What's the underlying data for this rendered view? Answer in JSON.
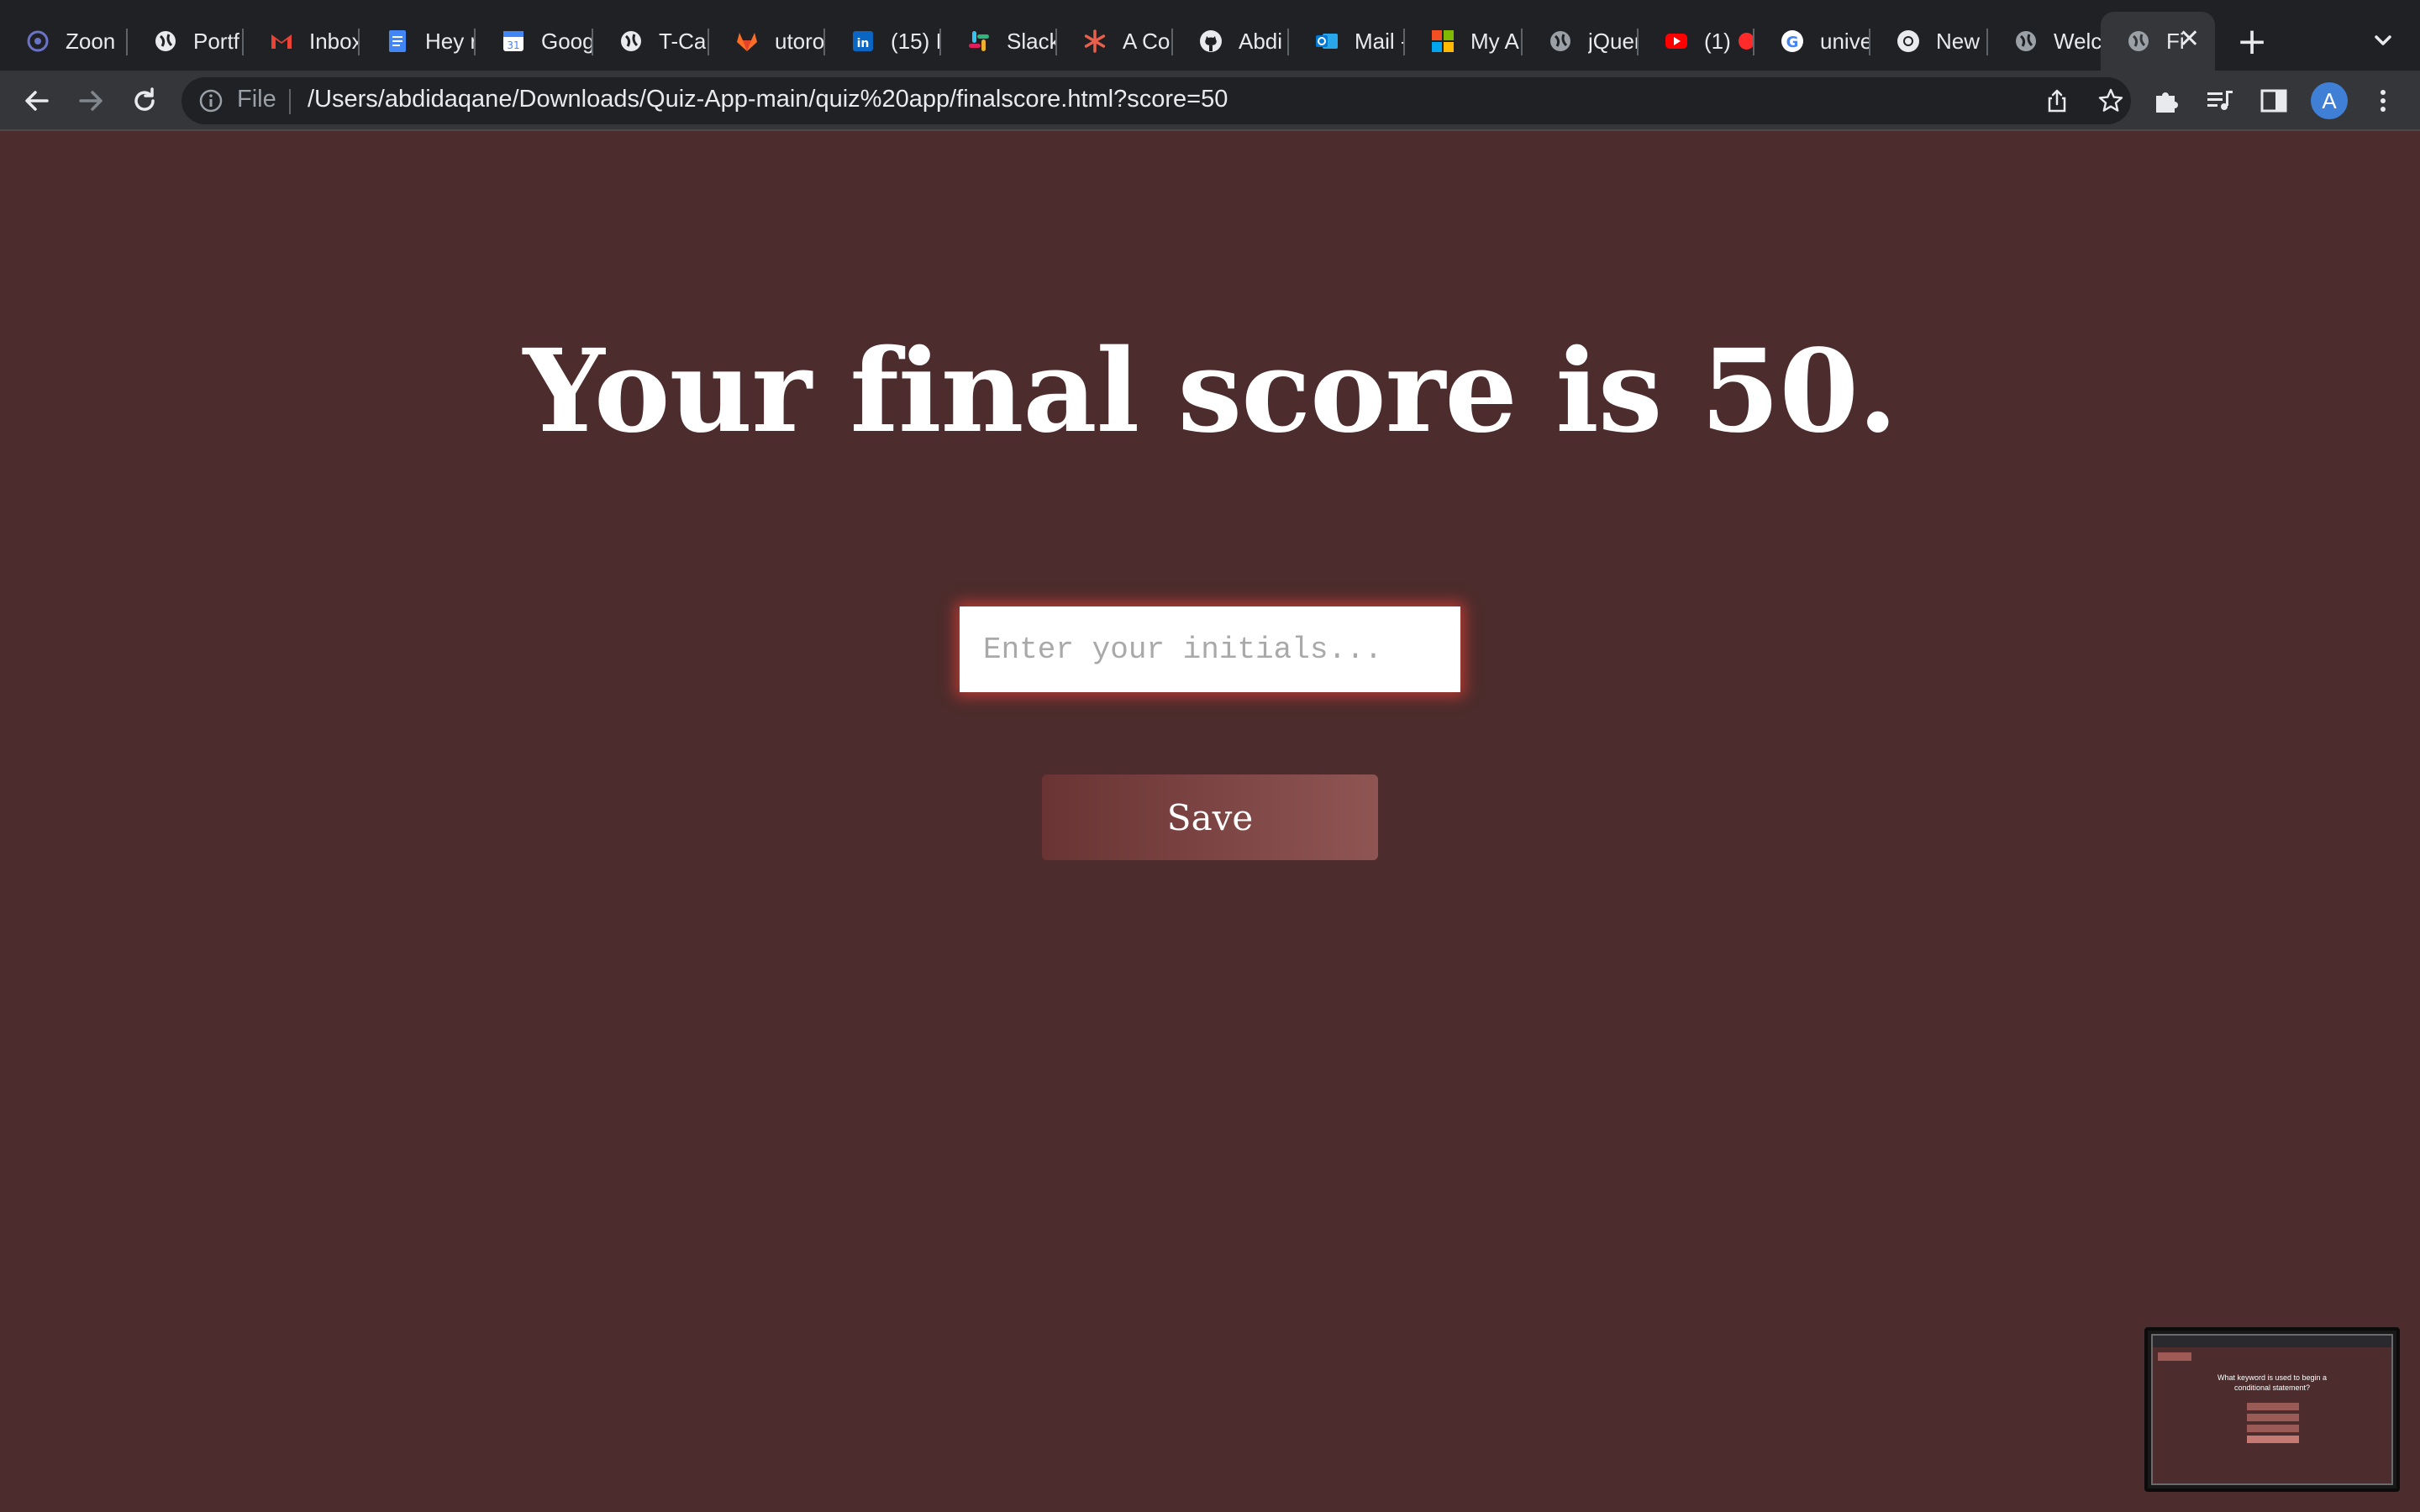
{
  "browser": {
    "tabs": [
      {
        "label": "Zoon",
        "icon": "zoom-icon",
        "color": "#6b73c9"
      },
      {
        "label": "Portf",
        "icon": "globe-icon",
        "color": "#e8eaed"
      },
      {
        "label": "Inbox",
        "icon": "gmail-icon",
        "color": "#ea4335"
      },
      {
        "label": "Hey r",
        "icon": "docs-icon",
        "color": "#4285f4"
      },
      {
        "label": "Goog",
        "icon": "calendar-icon",
        "color": "#4285f4"
      },
      {
        "label": "T-Ca",
        "icon": "globe-icon",
        "color": "#e8eaed"
      },
      {
        "label": "utoro",
        "icon": "gitlab-icon",
        "color": "#fc6d26"
      },
      {
        "label": "(15) I",
        "icon": "linkedin-icon",
        "color": "#0a66c2"
      },
      {
        "label": "Slack",
        "icon": "slack-icon",
        "color": "#e01e5a"
      },
      {
        "label": "A Co",
        "icon": "asterisk-icon",
        "color": "#e8604c"
      },
      {
        "label": "Abdi",
        "icon": "github-icon",
        "color": "#e8eaed"
      },
      {
        "label": "Mail -",
        "icon": "outlook-icon",
        "color": "#0078d4"
      },
      {
        "label": "My A",
        "icon": "microsoft-icon",
        "color": "#f25022"
      },
      {
        "label": "jQuer",
        "icon": "globe-icon",
        "color": "#e8eaed"
      },
      {
        "label": "(1)",
        "icon": "youtube-icon",
        "color": "#ff0000"
      },
      {
        "label": "unive",
        "icon": "google-icon",
        "color": "#4285f4"
      },
      {
        "label": "New",
        "icon": "chrome-icon",
        "color": "#e8eaed"
      },
      {
        "label": "Welc",
        "icon": "globe-icon",
        "color": "#e8eaed"
      },
      {
        "label": "Fi",
        "icon": "globe-icon",
        "color": "#e8eaed",
        "active": true
      }
    ],
    "new_tab_label": "+",
    "omnibox": {
      "scheme_label": "File",
      "url": "/Users/abdidaqane/Downloads/Quiz-App-main/quiz%20app/finalscore.html?score=50"
    },
    "profile_initial": "A"
  },
  "page": {
    "title": "Your final score is 50.",
    "initials_placeholder": "Enter your initials...",
    "save_label": "Save"
  },
  "thumbnail": {
    "question": "What keyword is used to begin a conditional statement?"
  },
  "colors": {
    "page_background": "#4c2c2c",
    "input_glow": "#b43a32",
    "button_start": "#6a3434",
    "button_end": "#8e5553"
  }
}
